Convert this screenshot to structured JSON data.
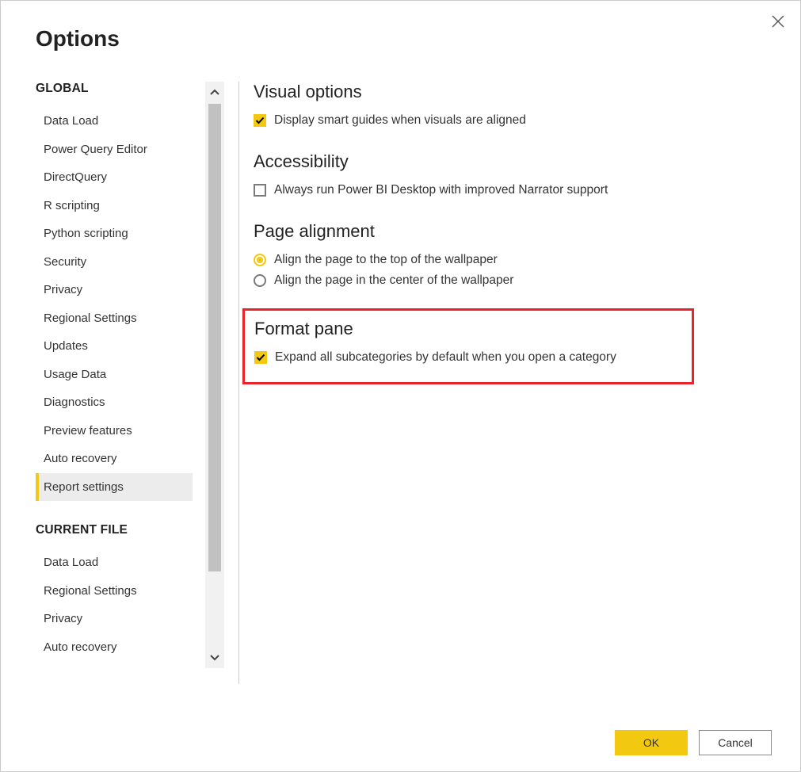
{
  "dialog": {
    "title": "Options",
    "ok_label": "OK",
    "cancel_label": "Cancel"
  },
  "sidebar": {
    "global_title": "GLOBAL",
    "current_file_title": "CURRENT FILE",
    "global": [
      "Data Load",
      "Power Query Editor",
      "DirectQuery",
      "R scripting",
      "Python scripting",
      "Security",
      "Privacy",
      "Regional Settings",
      "Updates",
      "Usage Data",
      "Diagnostics",
      "Preview features",
      "Auto recovery",
      "Report settings"
    ],
    "current_file": [
      "Data Load",
      "Regional Settings",
      "Privacy",
      "Auto recovery"
    ],
    "selected": "Report settings"
  },
  "content": {
    "visual_options": {
      "title": "Visual options",
      "smart_guides": {
        "label": "Display smart guides when visuals are aligned",
        "checked": true
      }
    },
    "accessibility": {
      "title": "Accessibility",
      "narrator": {
        "label": "Always run Power BI Desktop with improved Narrator support",
        "checked": false
      }
    },
    "page_alignment": {
      "title": "Page alignment",
      "top": {
        "label": "Align the page to the top of the wallpaper",
        "checked": true
      },
      "center": {
        "label": "Align the page in the center of the wallpaper",
        "checked": false
      }
    },
    "format_pane": {
      "title": "Format pane",
      "expand_all": {
        "label": "Expand all subcategories by default when you open a category",
        "checked": true
      }
    }
  }
}
